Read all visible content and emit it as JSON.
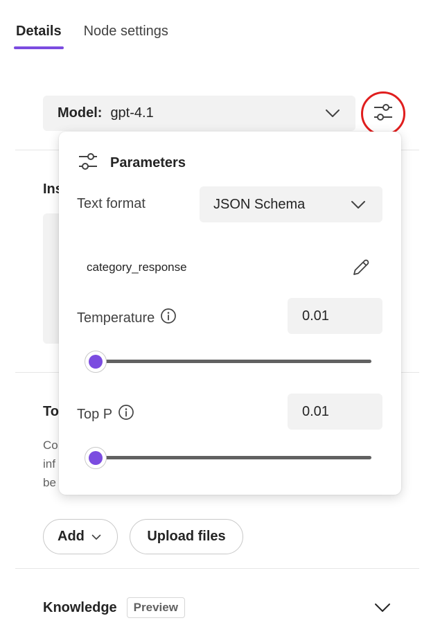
{
  "tabs": [
    {
      "label": "Details",
      "active": true
    },
    {
      "label": "Node settings",
      "active": false
    }
  ],
  "model": {
    "label": "Model:",
    "value": "gpt-4.1"
  },
  "background": {
    "instructions_heading": "Ins",
    "tools_heading": "To",
    "tools_desc_lines": [
      "Co",
      "inf",
      "be"
    ]
  },
  "actions": {
    "add_label": "Add",
    "upload_label": "Upload files"
  },
  "knowledge": {
    "title": "Knowledge",
    "badge": "Preview"
  },
  "parameters": {
    "title": "Parameters",
    "text_format": {
      "label": "Text format",
      "value": "JSON Schema"
    },
    "schema_name": "category_response",
    "temperature": {
      "label": "Temperature",
      "value": "0.01",
      "slider_fraction": 0.0
    },
    "top_p": {
      "label": "Top P",
      "value": "0.01",
      "slider_fraction": 0.0
    }
  },
  "colors": {
    "accent": "#7b4ce0",
    "highlight_ring": "#e01e1e"
  }
}
